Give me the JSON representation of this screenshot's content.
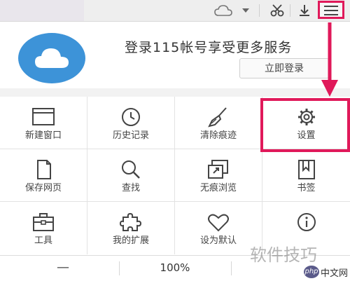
{
  "toolbar": {
    "icons": [
      "cloud-icon",
      "caret-down-icon",
      "scissors-icon",
      "download-icon",
      "menu-icon"
    ]
  },
  "login": {
    "prompt": "登录115帐号享受更多服务",
    "button_label": "立即登录"
  },
  "grid": {
    "items": [
      {
        "label": "新建窗口",
        "icon": "new-window-icon"
      },
      {
        "label": "历史记录",
        "icon": "history-clock-icon"
      },
      {
        "label": "清除痕迹",
        "icon": "broom-icon"
      },
      {
        "label": "设置",
        "icon": "gear-icon"
      },
      {
        "label": "保存网页",
        "icon": "document-icon"
      },
      {
        "label": "查找",
        "icon": "magnifier-icon"
      },
      {
        "label": "无痕浏览",
        "icon": "incognito-window-icon"
      },
      {
        "label": "书签",
        "icon": "bookmark-icon"
      },
      {
        "label": "工具",
        "icon": "toolbox-icon"
      },
      {
        "label": "我的扩展",
        "icon": "puzzle-icon"
      },
      {
        "label": "设为默认",
        "icon": "heart-icon"
      },
      {
        "label": "",
        "icon": "info-icon"
      }
    ]
  },
  "zoom": {
    "minus": "—",
    "value": "100%",
    "plus": ""
  },
  "watermark": {
    "text1": "软件技巧",
    "logo": "php",
    "text2": "中文网"
  },
  "colors": {
    "highlight": "#e0195a",
    "avatar": "#3d93d8"
  }
}
